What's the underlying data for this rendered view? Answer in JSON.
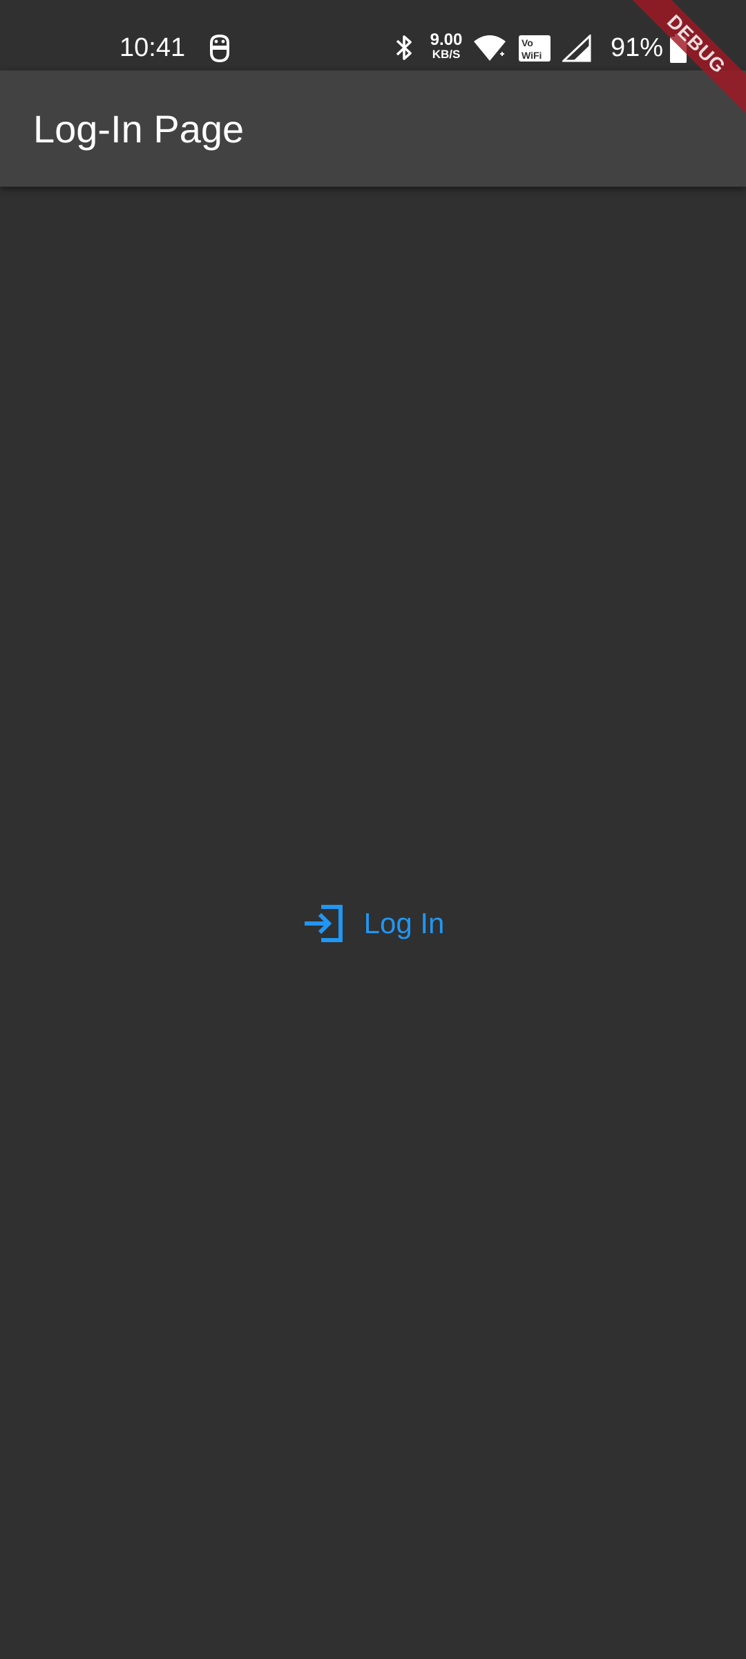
{
  "status_bar": {
    "time": "10:41",
    "net_speed_value": "9.00",
    "net_speed_unit": "KB/S",
    "battery_percent": "91%",
    "icons": [
      "notification-app-icon",
      "bluetooth-icon",
      "wifi-icon",
      "vowifi-icon",
      "cellular-signal-icon",
      "battery-icon"
    ]
  },
  "app_bar": {
    "title": "Log-In Page"
  },
  "main": {
    "login_button_label": "Log In",
    "login_icon": "login-icon"
  },
  "debug_banner": {
    "label": "DEBUG"
  },
  "colors": {
    "background": "#303030",
    "app_bar": "#424242",
    "accent": "#2196f3",
    "debug_banner": "#a01824"
  }
}
